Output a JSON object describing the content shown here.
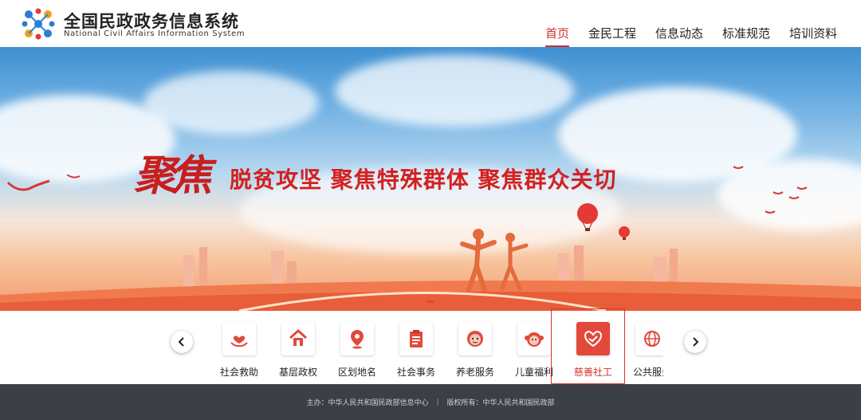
{
  "header": {
    "brand_cn": "全国民政政务信息系统",
    "brand_en": "National Civil Affairs Information System",
    "nav": [
      {
        "label": "首页",
        "active": true
      },
      {
        "label": "金民工程",
        "active": false
      },
      {
        "label": "信息动态",
        "active": false
      },
      {
        "label": "标准规范",
        "active": false
      },
      {
        "label": "培训资料",
        "active": false
      }
    ]
  },
  "banner": {
    "slogan_big": "聚焦",
    "slogan": "脱贫攻坚  聚焦特殊群体  聚焦群众关切"
  },
  "services": {
    "items": [
      {
        "label": "社会救助",
        "icon": "hands-heart-icon"
      },
      {
        "label": "基层政权",
        "icon": "house-icon"
      },
      {
        "label": "区划地名",
        "icon": "map-pin-icon"
      },
      {
        "label": "社会事务",
        "icon": "clipboard-icon"
      },
      {
        "label": "养老服务",
        "icon": "elder-face-icon"
      },
      {
        "label": "儿童福利",
        "icon": "child-face-icon"
      },
      {
        "label": "慈善社工",
        "icon": "heart-handshake-icon"
      },
      {
        "label": "公共服务",
        "icon": "globe-icon"
      }
    ],
    "selected": "慈善社工"
  },
  "footer": {
    "host": "主办：中华人民共和国民政部信息中心",
    "separator": "|",
    "copyright": "版权所有：中华人民共和国民政部"
  },
  "colors": {
    "accent": "#d32f2f",
    "footer_bg": "#3d3f46",
    "selected_icon_bg": "#e2493a"
  }
}
